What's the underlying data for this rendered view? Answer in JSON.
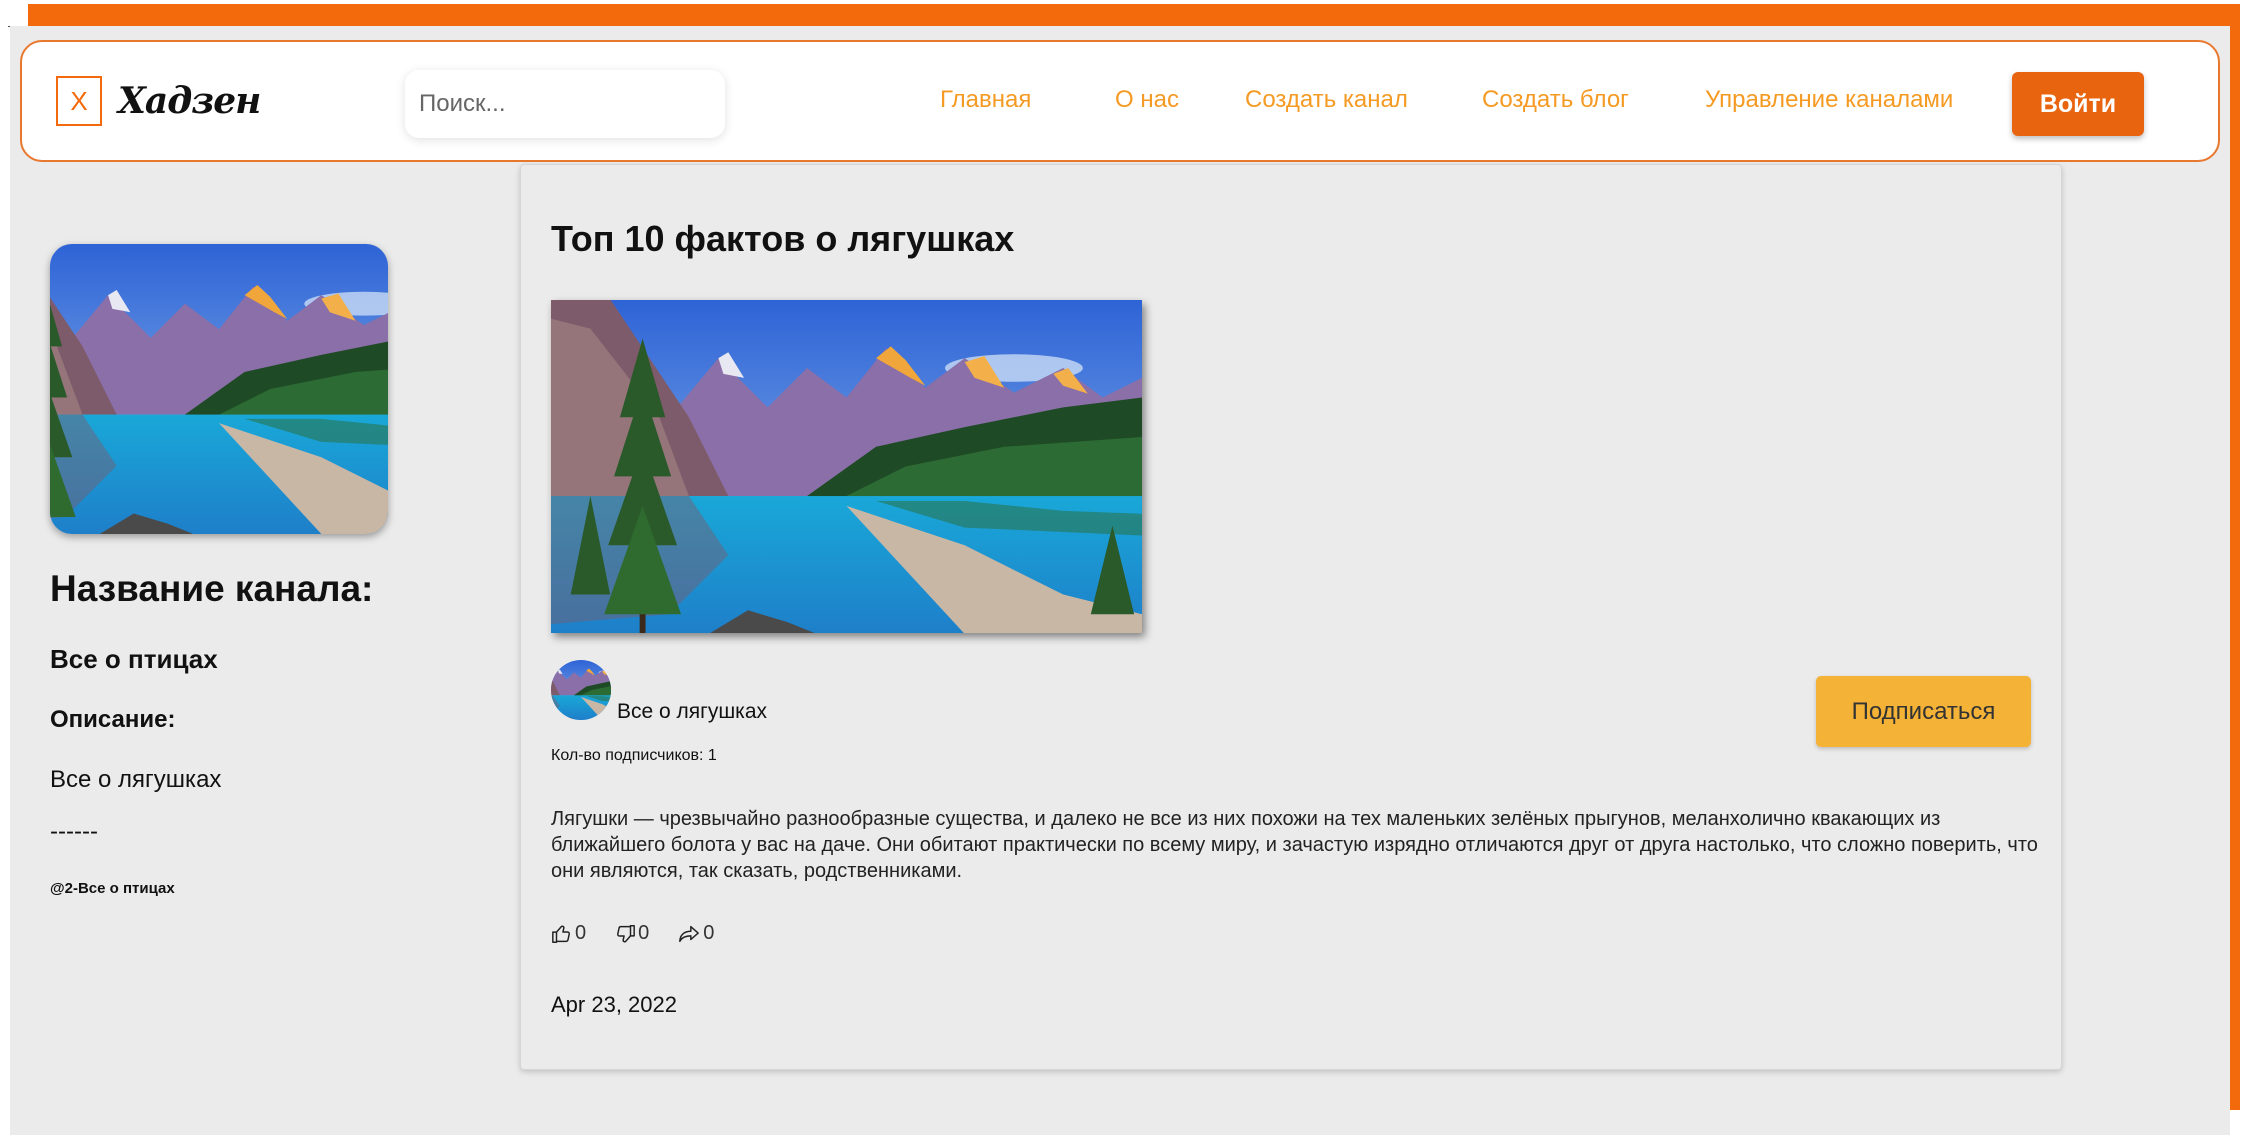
{
  "header": {
    "logo_letter": "X",
    "logo_text": "Хадзен",
    "search_placeholder": "Поиск...",
    "nav": [
      "Главная",
      "О нас",
      "Создать канал",
      "Создать блог",
      "Управление каналами"
    ],
    "login_label": "Войти"
  },
  "sidebar": {
    "heading": "Название канала:",
    "channel_name": "Все о птицах",
    "description_label": "Описание:",
    "description": "Все о лягушках",
    "separator": "------",
    "handle": "@2-Все о птицах"
  },
  "post": {
    "title": "Топ 10 фактов о лягушках",
    "author": "Все о лягушках",
    "subscribers_text": "Кол-во подписчиков: 1",
    "subscribe_label": "Подписаться",
    "body": "Лягушки — чрезвычайно разнообразные существа, и далеко не все из них похожи на тех маленьких зелёных прыгунов, меланхолично квакающих из ближайшего болота у вас на даче. Они обитают практически по всему миру, и зачастую изрядно отличаются друг от друга настолько, что сложно поверить, что они являются, так сказать, родственниками.",
    "likes": "0",
    "dislikes": "0",
    "shares": "0",
    "date": "Apr 23, 2022"
  },
  "colors": {
    "accent": "#f26a0b",
    "nav_link": "#f59a23",
    "subscribe": "#f4b336",
    "login": "#e8640e"
  },
  "icons": [
    "thumbs-up-icon",
    "thumbs-down-icon",
    "share-icon"
  ]
}
